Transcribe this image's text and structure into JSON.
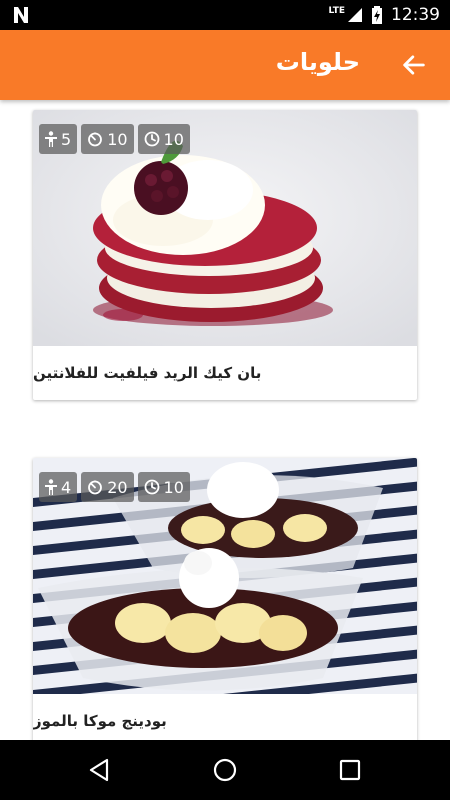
{
  "status_bar": {
    "network_label": "LTE",
    "time": "12:39"
  },
  "app_bar": {
    "title": "حلويات",
    "back_icon": "arrow-back-icon",
    "color": "#f97a28"
  },
  "recipes": [
    {
      "title": "بان كيك الريد فيلفيت للفلانتين",
      "servings": "5",
      "cook_time": "10",
      "prep_time": "10"
    },
    {
      "title": "بودينج موكا بالموز",
      "servings": "4",
      "cook_time": "20",
      "prep_time": "10"
    }
  ],
  "nav_bar": {
    "icons": [
      "back-triangle-icon",
      "home-circle-icon",
      "recents-square-icon"
    ]
  }
}
